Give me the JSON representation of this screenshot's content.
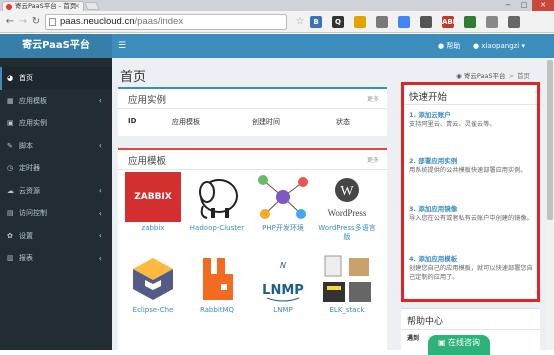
{
  "browser": {
    "tab_title": "寄云PaaS平台 - 首页",
    "url_host": "paas.neucloud.cn",
    "url_path": "/paas/index",
    "extension_icons": [
      "B",
      "Q",
      "",
      "",
      "",
      "",
      "ABP",
      "",
      "",
      ""
    ]
  },
  "header": {
    "logo": "寄云PaaS平台",
    "help_label": "帮助",
    "user_label": "xiaopangzi"
  },
  "sidebar": {
    "items": [
      {
        "label": "首页",
        "icon": "dashboard-icon",
        "active": true,
        "has_children": false
      },
      {
        "label": "应用模板",
        "icon": "th-icon",
        "active": false,
        "has_children": true
      },
      {
        "label": "应用实例",
        "icon": "cube-icon",
        "active": false,
        "has_children": false
      },
      {
        "label": "脚本",
        "icon": "edit-icon",
        "active": false,
        "has_children": true
      },
      {
        "label": "定时器",
        "icon": "clock-icon",
        "active": false,
        "has_children": false
      },
      {
        "label": "云资源",
        "icon": "cloud-icon",
        "active": false,
        "has_children": true
      },
      {
        "label": "访问控制",
        "icon": "lock-icon",
        "active": false,
        "has_children": true
      },
      {
        "label": "设置",
        "icon": "gear-icon",
        "active": false,
        "has_children": true
      },
      {
        "label": "报表",
        "icon": "chart-icon",
        "active": false,
        "has_children": true
      }
    ]
  },
  "page": {
    "title": "首页",
    "breadcrumb_home": "寄云PaaS平台",
    "breadcrumb_current": "首页"
  },
  "instances": {
    "title": "应用实例",
    "more": "更多",
    "columns": [
      "ID",
      "应用模板",
      "创建时间",
      "状态"
    ]
  },
  "templates": {
    "title": "应用模板",
    "more": "更多",
    "items": [
      {
        "label": "zabbix"
      },
      {
        "label": "Hadoop-Cluster"
      },
      {
        "label": "PHP开发环境"
      },
      {
        "label": "WordPress多语言版"
      },
      {
        "label": "Eclipse-Che"
      },
      {
        "label": "RabbitMQ"
      },
      {
        "label": "LNMP"
      },
      {
        "label": "ELK_stack"
      }
    ],
    "logo_texts": {
      "zabbix": "ZABBIX",
      "wordpress": "WordPress",
      "rabbitmq": "RabbitMQ",
      "lnmp": "LNMP"
    }
  },
  "quickstart": {
    "title": "快速开始",
    "steps": [
      {
        "heading": "1. 添加云账户",
        "desc": "支持阿里云、青云、灵雀云等。"
      },
      {
        "heading": "2. 部署应用实例",
        "desc": "用系统提供的公共模板快速部署应用实例。"
      },
      {
        "heading": "3. 添加应用镜像",
        "desc": "导入您在公有或者私有云账户中创建的镜像。"
      },
      {
        "heading": "4. 添加应用模板",
        "desc": "创建您自己的应用模板，就可以快速部署您自己定制的应用了。"
      }
    ]
  },
  "help_center": {
    "title": "帮助中心",
    "sub": "遇到"
  },
  "chat": {
    "label": "在线咨询"
  },
  "colors": {
    "header": "#3c8dbc",
    "sidebar": "#222d32",
    "highlight_border": "#e02424",
    "chat": "#2db37a"
  }
}
